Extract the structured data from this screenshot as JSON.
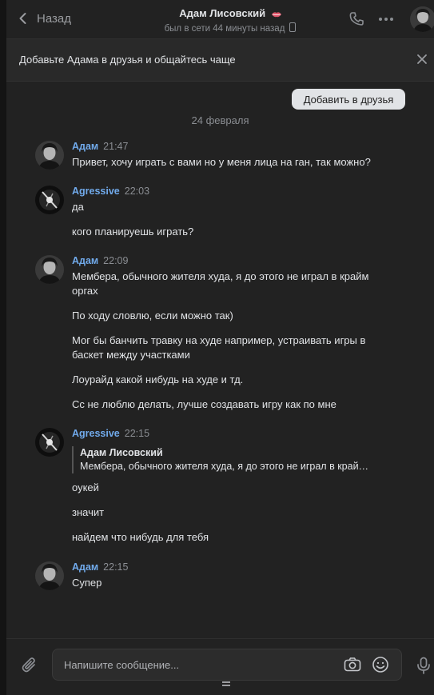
{
  "header": {
    "back_label": "Назад",
    "contact_name": "Адам Лисовский",
    "status": "был в сети 44 минуты назад"
  },
  "friendbar": {
    "text": "Добавьте Адама в друзья и общайтесь чаще",
    "add_button": "Добавить в друзья"
  },
  "chat": {
    "date_separator": "24 февраля",
    "messages": [
      {
        "author": "Адам",
        "time": "21:47",
        "lines": [
          "Привет, хочу играть с вами но у меня лица на ган, так можно?"
        ]
      },
      {
        "author": "Agressive",
        "time": "22:03",
        "lines": [
          "да",
          "кого планируешь играть?"
        ]
      },
      {
        "author": "Адам",
        "time": "22:09",
        "lines": [
          "Мембера, обычного жителя худа, я до этого не играл в крайм оргах",
          "По ходу словлю, если можно так)",
          "Мог бы банчить травку на худе например, устраивать игры в баскет между участками",
          "Лоурайд какой нибудь на худе и тд.",
          "Сс не люблю делать, лучше создавать игру как по мне"
        ]
      },
      {
        "author": "Agressive",
        "time": "22:15",
        "reply": {
          "name": "Адам Лисовский",
          "text": "Мембера, обычного жителя худа, я до этого не играл в край…"
        },
        "lines": [
          "оукей",
          "значит",
          "найдем что нибудь для тебя"
        ]
      },
      {
        "author": "Адам",
        "time": "22:15",
        "lines": [
          "Супер"
        ]
      }
    ]
  },
  "composer": {
    "placeholder": "Напишите сообщение..."
  },
  "colors": {
    "background": "#222222",
    "name_link": "#71aaeb",
    "text": "#e1e3e6",
    "muted": "#8b8e93"
  },
  "icons": [
    "chevron-left-icon",
    "lips-icon",
    "phone-icon",
    "mobile-icon",
    "more-icon",
    "close-icon",
    "paperclip-icon",
    "camera-icon",
    "smile-icon",
    "mic-icon",
    "drag-handle-icon"
  ]
}
